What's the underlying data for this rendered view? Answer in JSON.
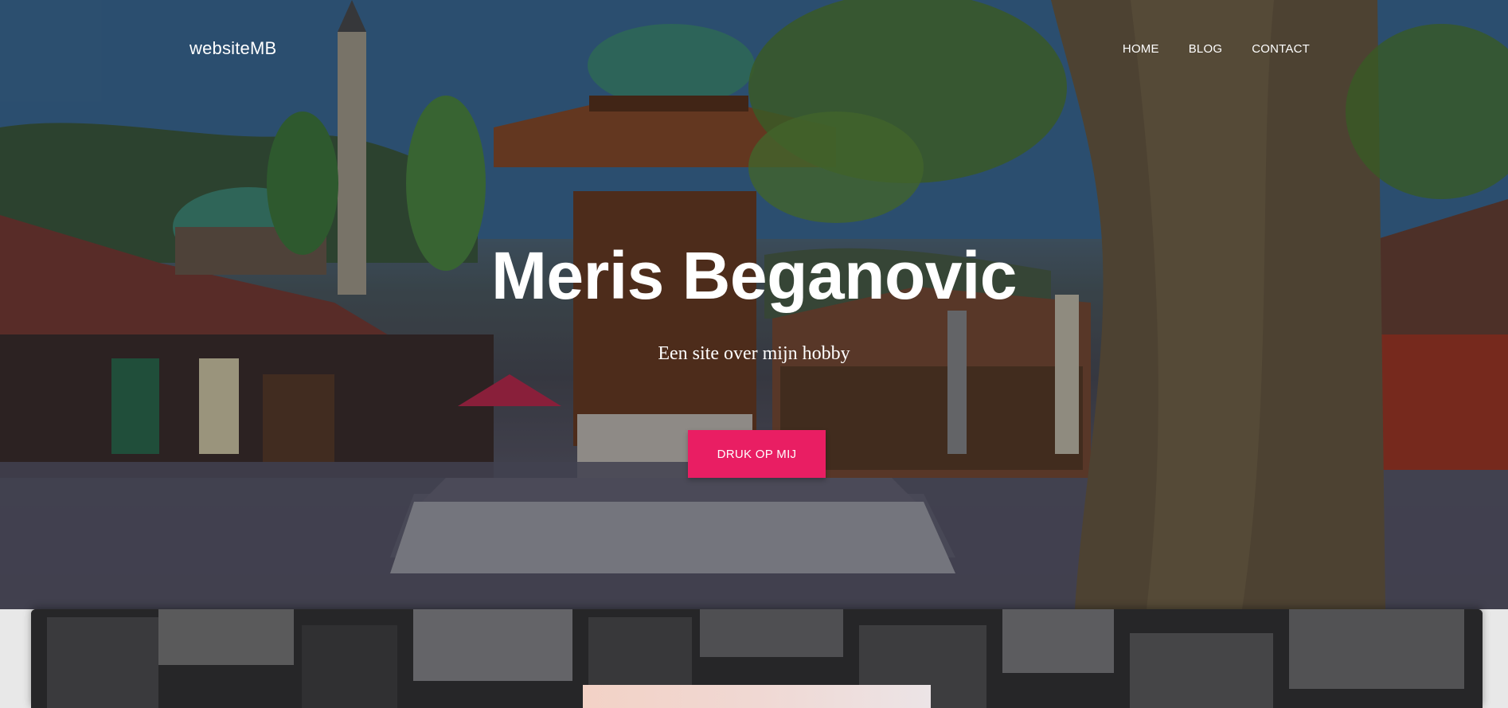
{
  "header": {
    "brand": "websiteMB",
    "nav": [
      {
        "label": "HOME"
      },
      {
        "label": "BLOG"
      },
      {
        "label": "CONTACT"
      }
    ]
  },
  "hero": {
    "title": "Meris Beganovic",
    "subtitle": "Een site over mijn hobby",
    "cta_label": "DRUK OP MIJ"
  },
  "colors": {
    "accent": "#e91e63",
    "text_light": "#ffffff",
    "card_bg": "#2d2d30"
  }
}
